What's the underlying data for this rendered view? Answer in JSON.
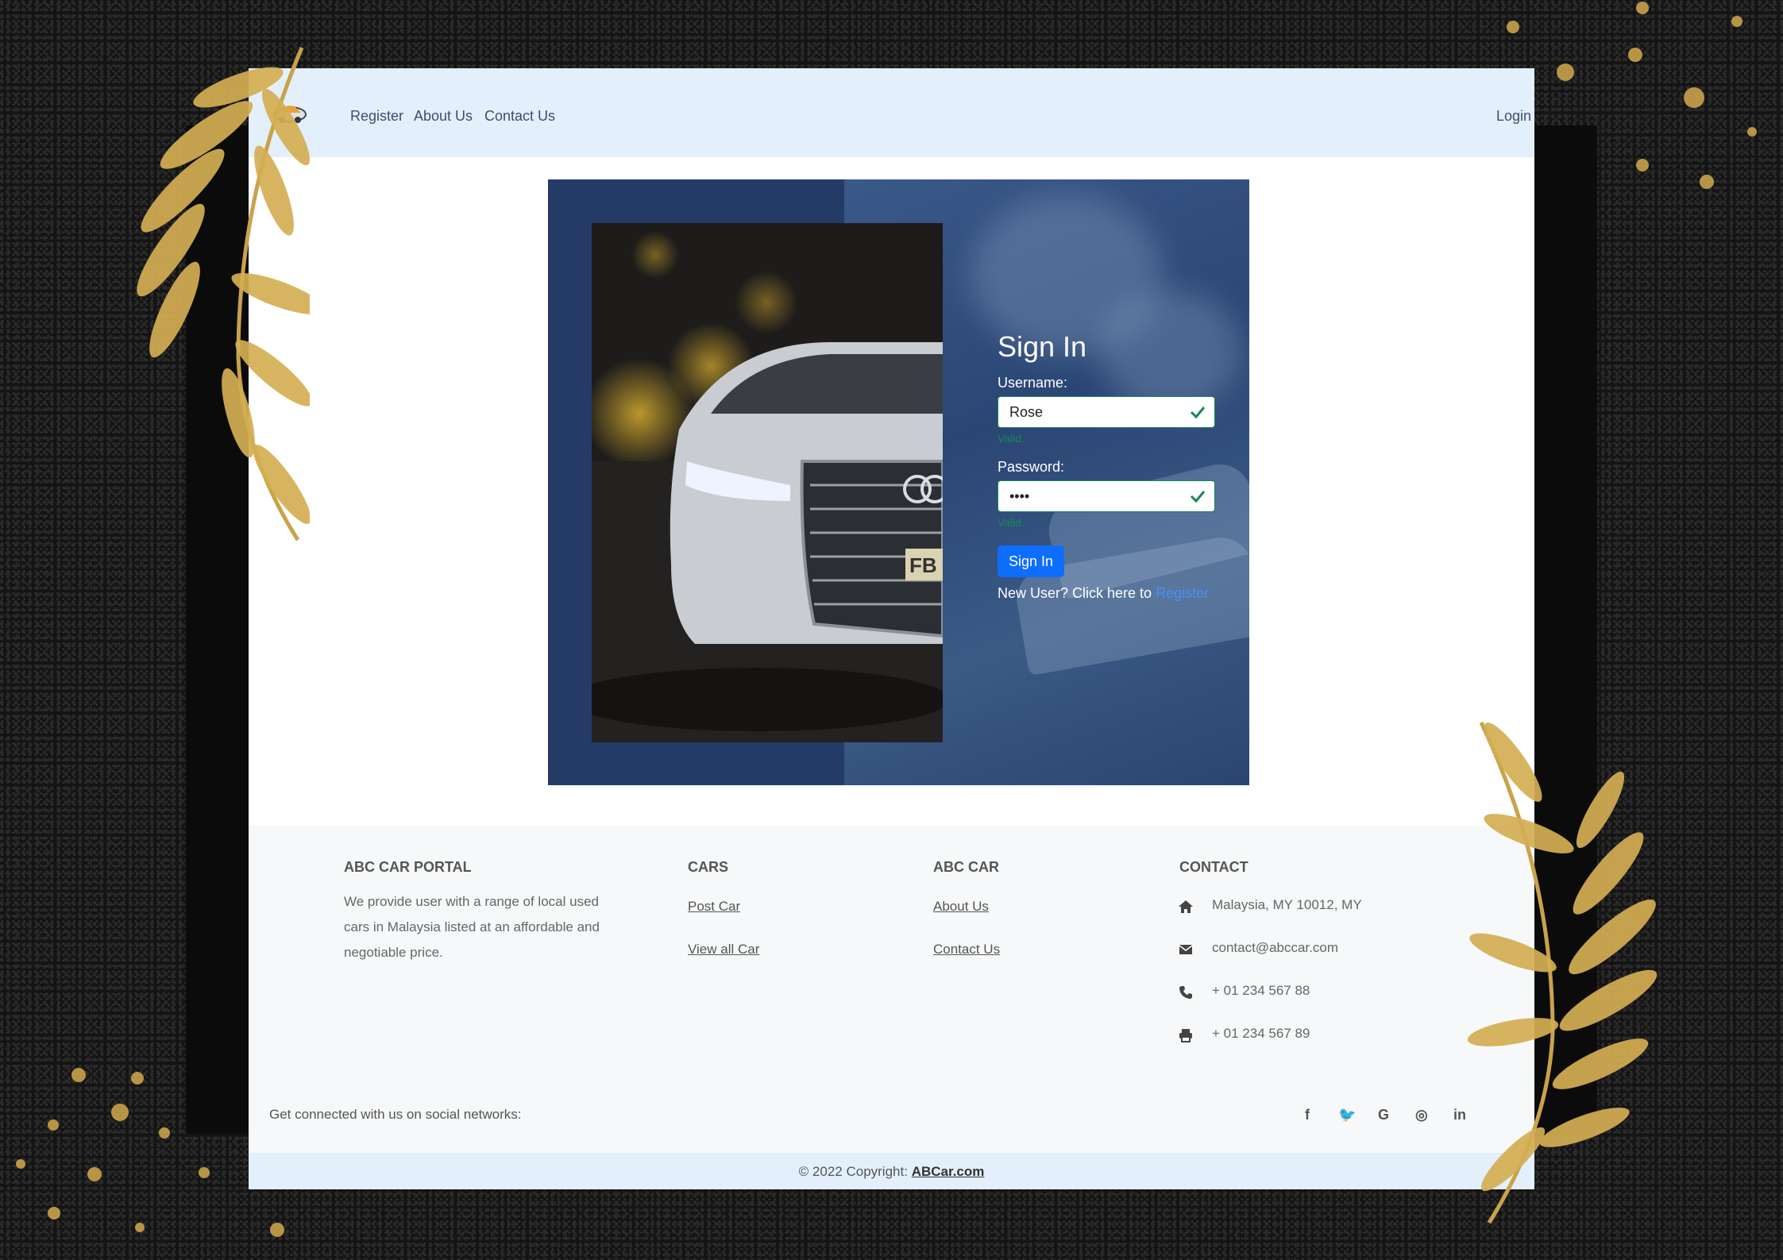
{
  "navbar": {
    "links": [
      "Register",
      "About Us",
      "Contact Us"
    ],
    "login": "Login"
  },
  "signin": {
    "title": "Sign In",
    "username_label": "Username:",
    "username_value": "Rose",
    "password_label": "Password:",
    "password_value": "••••",
    "valid_text": "Valid.",
    "button": "Sign In",
    "new_user_text": "New User? Click here to",
    "register_link": "Register"
  },
  "footer": {
    "portal_heading": "ABC CAR PORTAL",
    "portal_text_lines": [
      "We provide user with a range of local used",
      "cars in Malaysia listed at an affordable and",
      "negotiable price."
    ],
    "cars_heading": "CARS",
    "cars_links": [
      "Post Car",
      "View all Car"
    ],
    "abccar_heading": "ABC CAR",
    "abccar_links": [
      "About Us",
      "Contact Us"
    ],
    "contact_heading": "CONTACT",
    "contact_items": [
      {
        "icon": "home-icon",
        "text": "Malaysia, MY 10012, MY"
      },
      {
        "icon": "envelope-icon",
        "text": "contact@abccar.com"
      },
      {
        "icon": "phone-icon",
        "text": "+ 01 234 567 88"
      },
      {
        "icon": "printer-icon",
        "text": "+ 01 234 567 89"
      }
    ],
    "social_text": "Get connected with us on social networks:",
    "social": [
      "f",
      "🐦",
      "G",
      "◎",
      "in"
    ]
  },
  "copyright": {
    "text": "© 2022 Copyright:",
    "link": "ABCar.com"
  },
  "colors": {
    "navbar_bg": "#e3f0fc",
    "panel_bg": "#233b66",
    "primary_button": "#0d6efd",
    "valid_green": "#198754",
    "footer_bg": "#f6f8f9",
    "gold_decoration": "#c9a24a"
  }
}
